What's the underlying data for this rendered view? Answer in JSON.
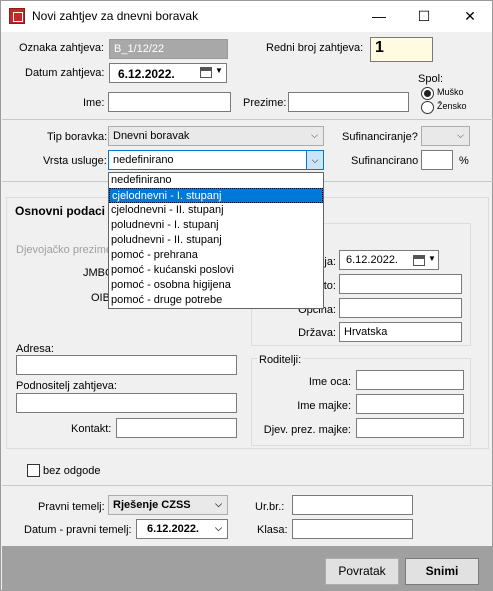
{
  "window": {
    "title": "Novi zahtjev za dnevni boravak",
    "minimize": "—",
    "maximize": "☐",
    "close": "✕"
  },
  "header": {
    "oznaka_label": "Oznaka zahtjeva:",
    "oznaka_value": "B_1/12/22",
    "redni_label": "Redni broj zahtjeva:",
    "redni_value": "1",
    "datum_label": "Datum zahtjeva:",
    "datum_value": "6.12.2022.",
    "ime_label": "Ime:",
    "ime_value": "",
    "prezime_label": "Prezime:",
    "prezime_value": "",
    "spol_label": "Spol:",
    "spol_options": [
      "Muško",
      "Žensko"
    ],
    "spol_selected": "Muško"
  },
  "service": {
    "tip_label": "Tip boravka:",
    "tip_value": "Dnevni boravak",
    "vrsta_label": "Vrsta usluge:",
    "vrsta_value": "nedefinirano",
    "sufin_q_label": "Sufinanciranje?",
    "sufin_q_value": "",
    "sufin_label": "Sufinancirano",
    "sufin_value": "",
    "sufin_unit": "%"
  },
  "dropdown_options": [
    "nedefinirano",
    "cjelodnevni - I. stupanj",
    "cjelodnevni - II. stupanj",
    "poludnevni - I. stupanj",
    "poludnevni - II. stupanj",
    "pomoć - prehrana",
    "pomoć - kućanski poslovi",
    "pomoć - osobna higijena",
    "pomoć - druge potrebe"
  ],
  "dropdown_selected_index": 1,
  "basic": {
    "section_title": "Osnovni podaci",
    "djevojacko_label": "Djevojačko prezime:",
    "jmbg_label": "JMBG:",
    "oib_label": "OIB:",
    "datum_rod_label": "Datum rođenja:",
    "datum_rod_value": "6.12.2022.",
    "mjesto_label": "Mjesto:",
    "opcina_label": "Općina:",
    "drzava_label": "Država:",
    "drzava_value": "Hrvatska",
    "adresa_label": "Adresa:",
    "podnositelj_label": "Podnositelj zahtjeva:",
    "kontakt_label": "Kontakt:",
    "roditelji_label": "Roditelji:",
    "ime_oca_label": "Ime oca:",
    "ime_majke_label": "Ime majke:",
    "djev_majke_label": "Djev. prez. majke:"
  },
  "footer_form": {
    "bez_odgode_label": "bez odgode",
    "pravni_temelj_label": "Pravni temelj:",
    "pravni_temelj_value": "Rješenje CZSS",
    "datum_pravni_label": "Datum - pravni temelj:",
    "datum_pravni_value": "6.12.2022.",
    "urbr_label": "Ur.br.:",
    "klasa_label": "Klasa:"
  },
  "buttons": {
    "povratak": "Povratak",
    "snimi": "Snimi"
  }
}
